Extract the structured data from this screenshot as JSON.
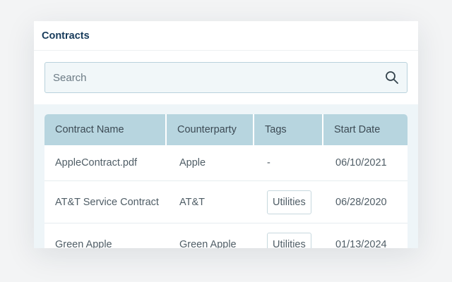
{
  "header": {
    "title": "Contracts"
  },
  "search": {
    "placeholder": "Search",
    "icon": "search-icon"
  },
  "table": {
    "columns": [
      "Contract Name",
      "Counterparty",
      "Tags",
      "Start Date"
    ],
    "rows": [
      {
        "name": "AppleContract.pdf",
        "counterparty": "Apple",
        "tags": "-",
        "start_date": "06/10/2021"
      },
      {
        "name": "AT&T Service Contract",
        "counterparty": "AT&T",
        "tags": "Utilities",
        "start_date": "06/28/2020"
      },
      {
        "name": "Green Apple",
        "counterparty": "Green Apple",
        "tags": "Utilities",
        "start_date": "01/13/2024"
      }
    ]
  },
  "colors": {
    "title": "#163a5a",
    "header_bg": "#b7d5df",
    "search_border": "#b9d2dc",
    "search_bg": "#f1f7f9"
  }
}
